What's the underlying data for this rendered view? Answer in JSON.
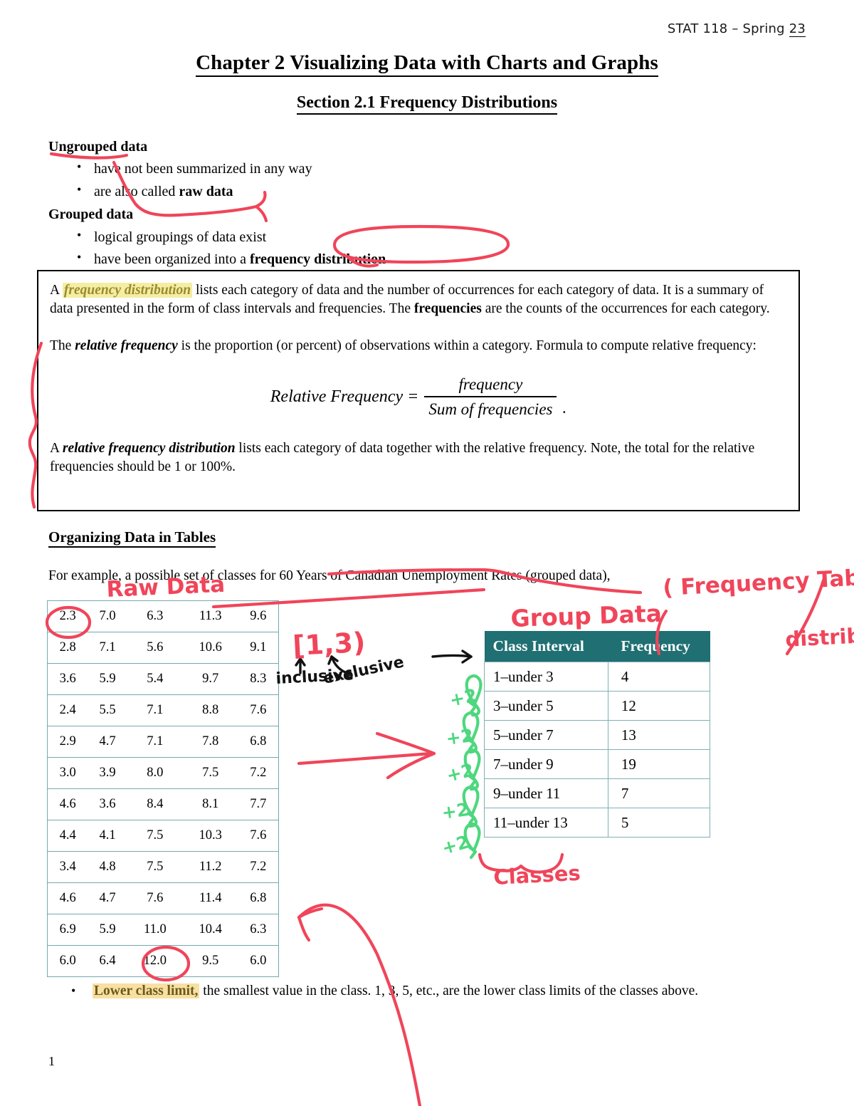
{
  "header": {
    "course": "STAT 118 – Spring ",
    "term_year": "23"
  },
  "titles": {
    "chapter": "Chapter 2 Visualizing Data with Charts and Graphs",
    "section": "Section 2.1 Frequency Distributions"
  },
  "outline": {
    "ungrouped_label": "Ungrouped data",
    "ungrouped_items": [
      {
        "pre": "have not been summarized in any way",
        "bold": "",
        "post": ""
      },
      {
        "pre": "are also called ",
        "bold": "raw data",
        "post": ""
      }
    ],
    "grouped_label": "Grouped data",
    "grouped_items": [
      {
        "pre": "logical groupings of data exist",
        "bold": "",
        "post": ""
      },
      {
        "pre": "have been organized into a ",
        "bold": "frequency distribution",
        "post": ""
      }
    ]
  },
  "definition_box": {
    "p1_a": "A ",
    "p1_term": "frequency distribution",
    "p1_b": " lists each category of data and the number of occurrences for each category of data. It is a summary of data presented in the form of class intervals and frequencies. The ",
    "p1_bold": "frequencies",
    "p1_c": " are the counts of the occurrences for each category.",
    "p2_a": "The ",
    "p2_term": "relative frequency",
    "p2_b": " is the proportion (or percent) of observations within a category. Formula to compute relative frequency:",
    "formula": {
      "lhs": "Relative Frequency =",
      "numerator": "frequency",
      "denominator": "Sum of frequencies",
      "trailing": "."
    },
    "p3_a": "A ",
    "p3_term": "relative frequency distribution",
    "p3_b": " lists each category of data together with the relative frequency. Note, the total for the relative frequencies should be 1 or 100%."
  },
  "organizing": {
    "heading": "Organizing Data in Tables",
    "example_line": "For example, a possible set of classes for 60 Years of Canadian Unemployment Rates (grouped data),"
  },
  "raw_data": {
    "rows": [
      [
        "2.3",
        "7.0",
        "6.3",
        "11.3",
        "9.6"
      ],
      [
        "2.8",
        "7.1",
        "5.6",
        "10.6",
        "9.1"
      ],
      [
        "3.6",
        "5.9",
        "5.4",
        "9.7",
        "8.3"
      ],
      [
        "2.4",
        "5.5",
        "7.1",
        "8.8",
        "7.6"
      ],
      [
        "2.9",
        "4.7",
        "7.1",
        "7.8",
        "6.8"
      ],
      [
        "3.0",
        "3.9",
        "8.0",
        "7.5",
        "7.2"
      ],
      [
        "4.6",
        "3.6",
        "8.4",
        "8.1",
        "7.7"
      ],
      [
        "4.4",
        "4.1",
        "7.5",
        "10.3",
        "7.6"
      ],
      [
        "3.4",
        "4.8",
        "7.5",
        "11.2",
        "7.2"
      ],
      [
        "4.6",
        "4.7",
        "7.6",
        "11.4",
        "6.8"
      ],
      [
        "6.9",
        "5.9",
        "11.0",
        "10.4",
        "6.3"
      ],
      [
        "6.0",
        "6.4",
        "12.0",
        "9.5",
        "6.0"
      ]
    ]
  },
  "frequency_table": {
    "headers": [
      "Class Interval",
      "Frequency"
    ],
    "rows": [
      [
        "1–under 3",
        "4"
      ],
      [
        "3–under 5",
        "12"
      ],
      [
        "5–under 7",
        "13"
      ],
      [
        "7–under 9",
        "19"
      ],
      [
        "9–under 11",
        "7"
      ],
      [
        "11–under 13",
        "5"
      ]
    ]
  },
  "lower_limit_bullet": {
    "term": "Lower class limit,",
    "text": " the smallest value in the class. 1, 3, 5, etc., are the lower class limits of the classes above."
  },
  "page_number": "1",
  "annotations": {
    "raw_data": "Raw Data",
    "group_data": "Group Data",
    "frequency_table": "( Frequency Table/",
    "distribution": "distribution",
    "interval_notation": "[1,3)",
    "inclusive": "inclusive",
    "exclusive": "exclusive",
    "classes": "Classes",
    "plus_two": [
      "+2",
      "+2",
      "+2",
      "+2",
      "+2"
    ]
  },
  "colors": {
    "ink_red": "#f0455a",
    "ink_green": "#4ed77e",
    "ink_black": "#121212",
    "table_teal": "#1f6f73",
    "table_border": "#74a9ad",
    "highlight_yellow": "#f4eda3",
    "highlight_orange": "#f8dfa2"
  }
}
